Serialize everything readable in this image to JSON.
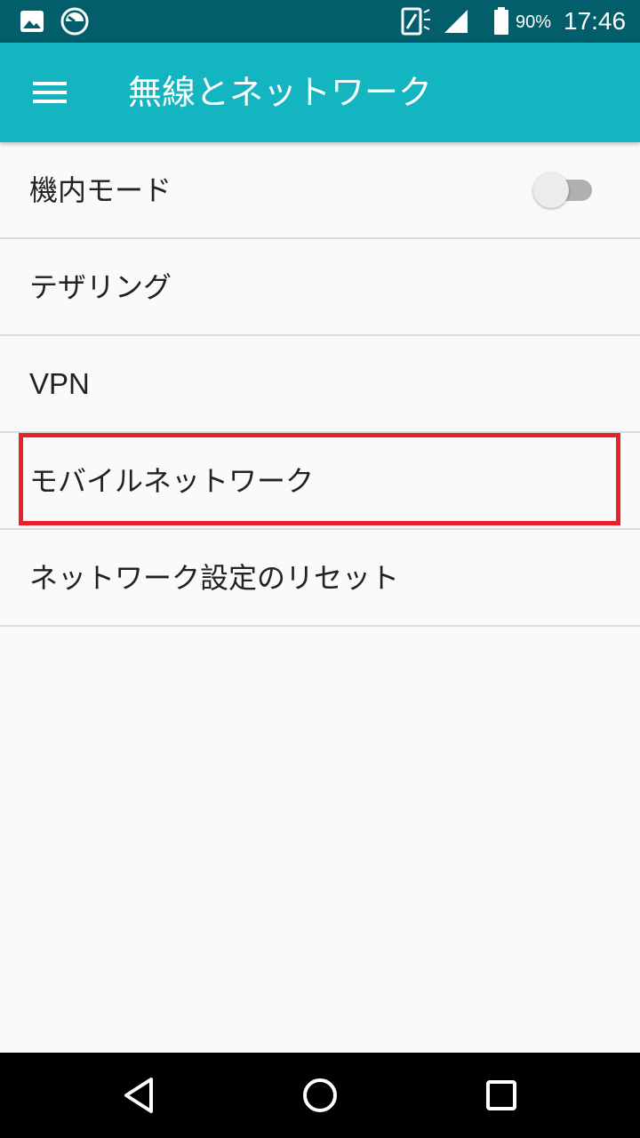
{
  "status_bar": {
    "battery_percent": "90%",
    "clock": "17:46",
    "icons": [
      "image-icon",
      "speedometer-icon",
      "vibrate-icon",
      "signal-icon",
      "battery-icon"
    ]
  },
  "app_bar": {
    "title": "無線とネットワーク",
    "background_color": "#13b6c0"
  },
  "settings": {
    "items": [
      {
        "label": "機内モード",
        "toggle": false
      },
      {
        "label": "テザリング"
      },
      {
        "label": "VPN"
      },
      {
        "label": "モバイルネットワーク",
        "highlighted": true
      },
      {
        "label": "ネットワーク設定のリセット"
      }
    ]
  },
  "highlight_color": "#e8202a",
  "nav_bar": {
    "icons": [
      "back-icon",
      "home-icon",
      "recents-icon"
    ]
  }
}
